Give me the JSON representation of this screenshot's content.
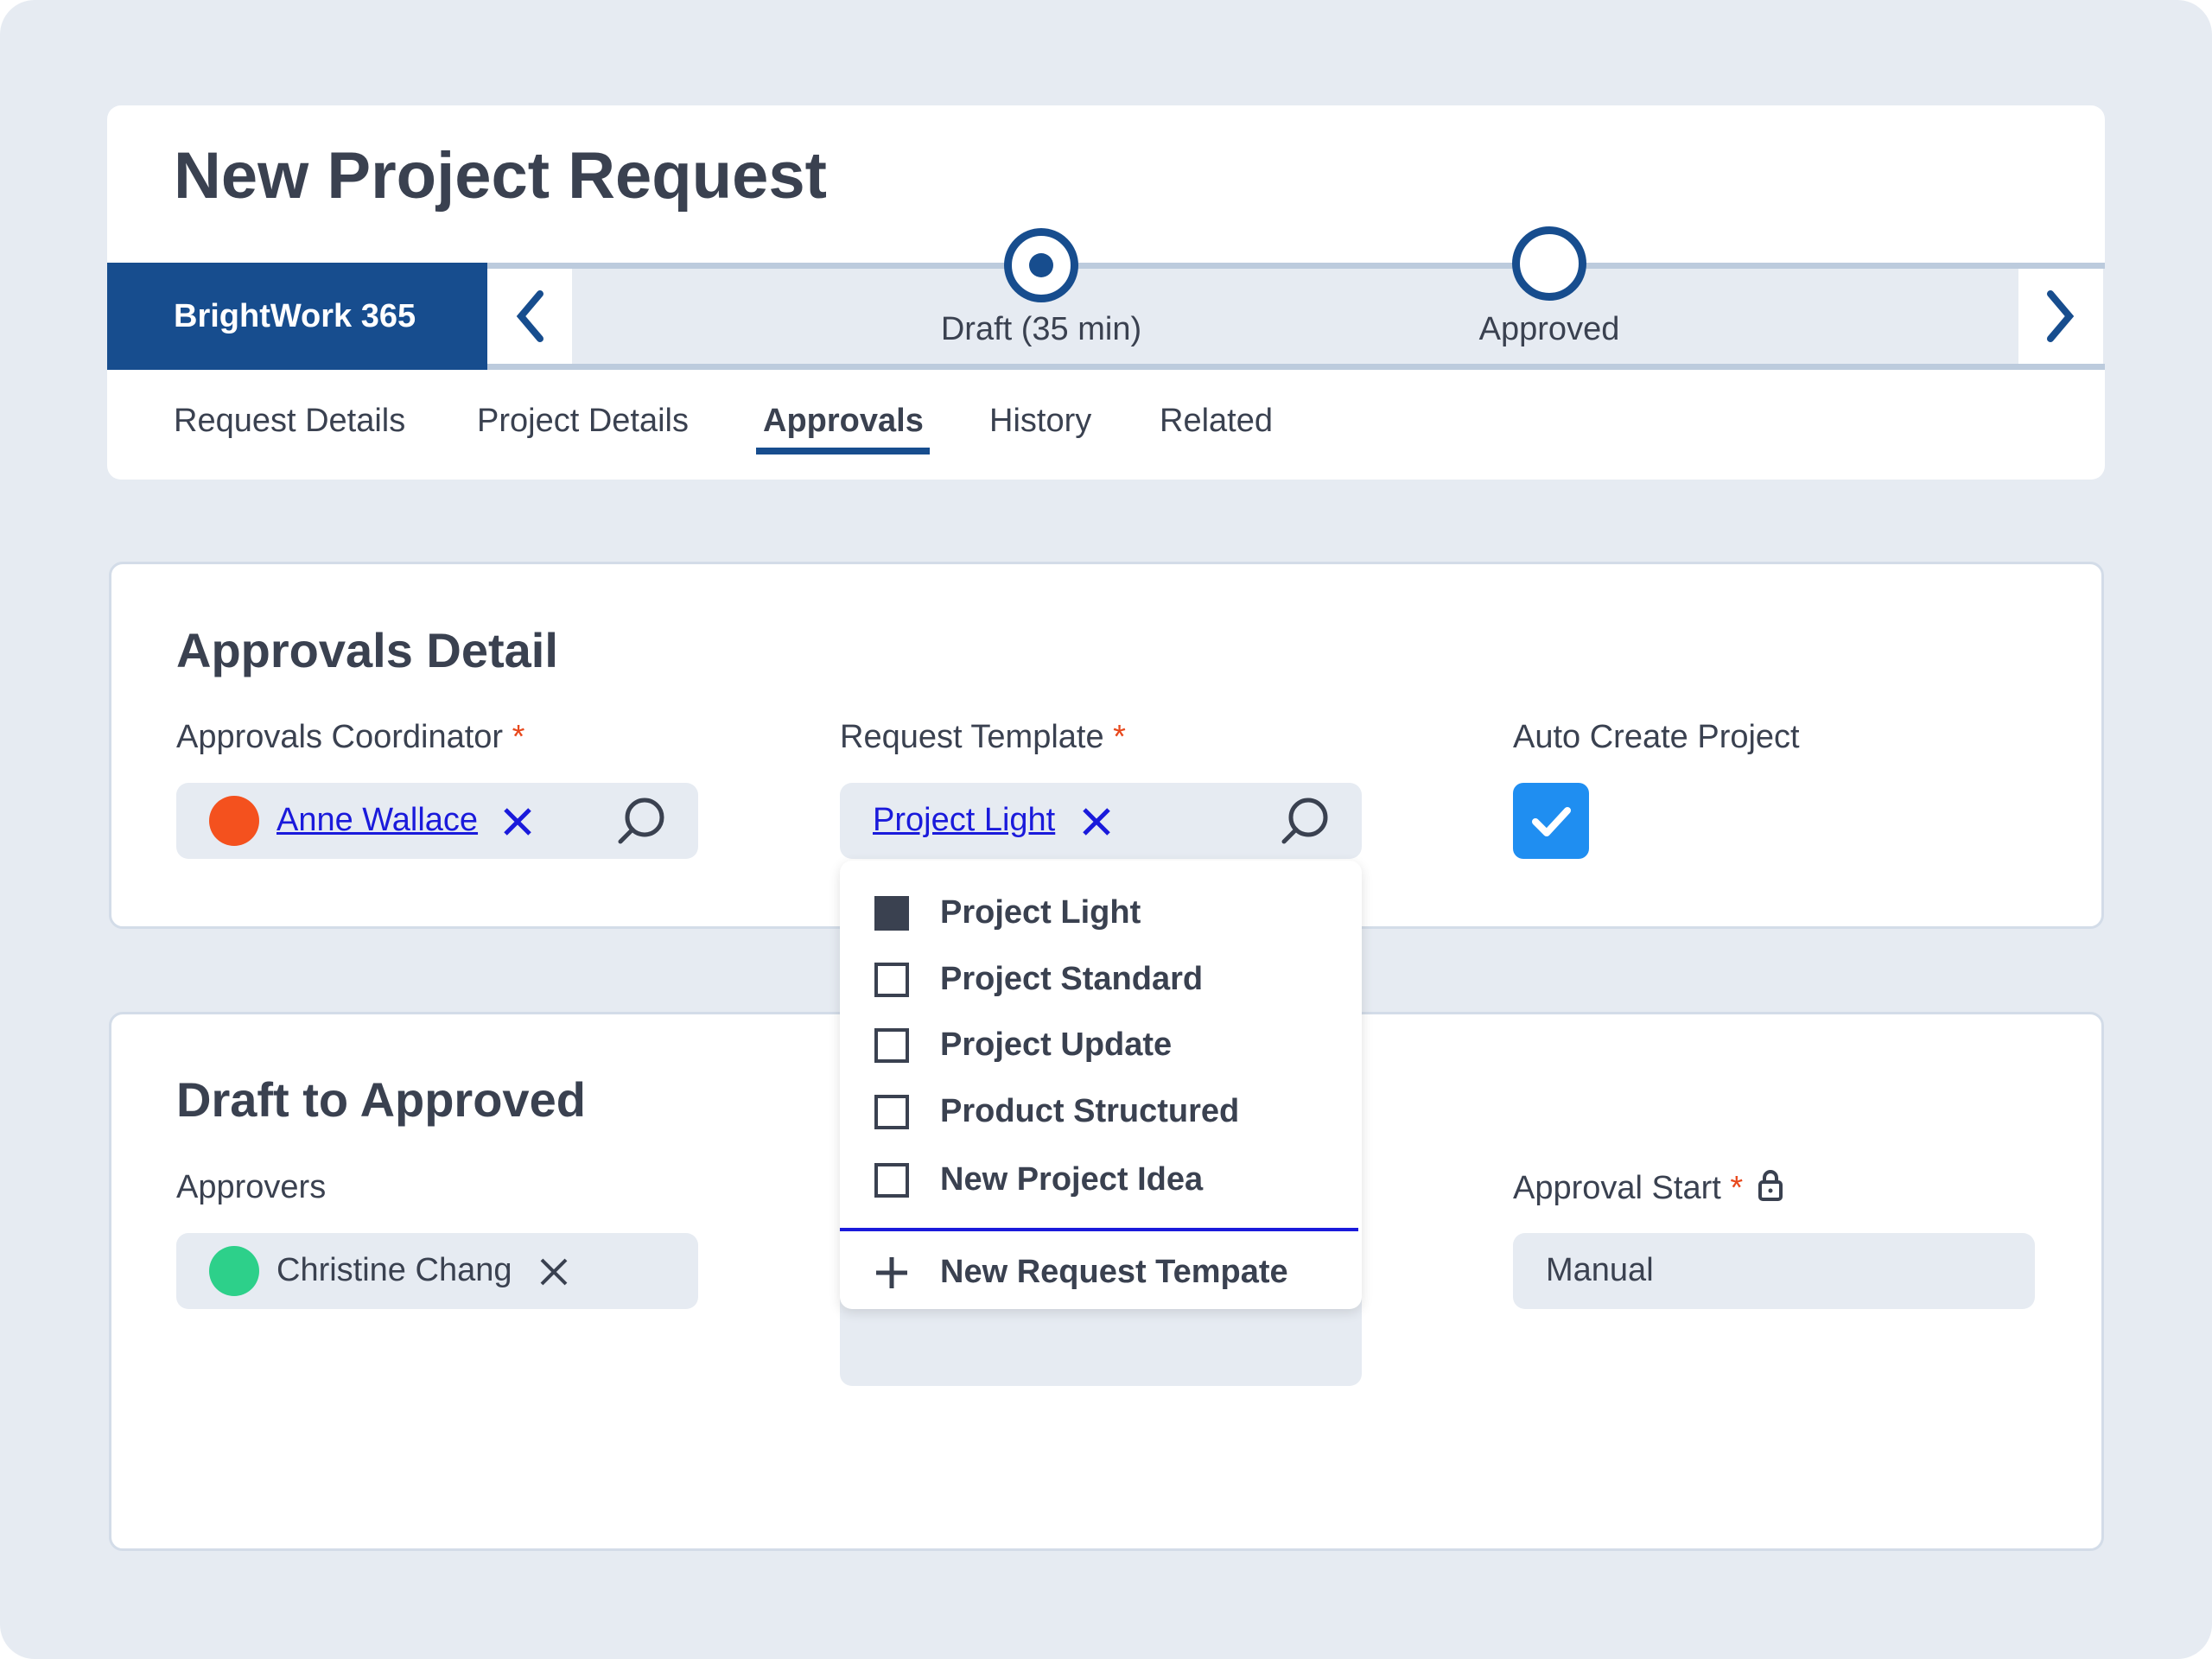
{
  "header": {
    "title": "New Project Request",
    "brand": "BrightWork 365"
  },
  "stages": [
    {
      "label": "Draft (35 min)",
      "state": "current"
    },
    {
      "label": "Approved",
      "state": "upcoming"
    }
  ],
  "tabs": [
    {
      "label": "Request Details"
    },
    {
      "label": "Project Details"
    },
    {
      "label": "Approvals",
      "active": true
    },
    {
      "label": "History"
    },
    {
      "label": "Related"
    }
  ],
  "approvals_detail": {
    "heading": "Approvals Detail",
    "coordinator": {
      "label": "Approvals Coordinator",
      "required": "*",
      "value": "Anne Wallace",
      "avatar_color": "#f4511e"
    },
    "template": {
      "label": "Request Template",
      "required": "*",
      "value": "Project Light"
    },
    "auto_create": {
      "label": "Auto Create Project",
      "checked": true,
      "color": "#1f8ef1"
    }
  },
  "draft_to_approved": {
    "heading": "Draft to Approved",
    "approvers": {
      "label": "Approvers",
      "value": "Christine Chang",
      "avatar_color": "#2dd08a"
    },
    "approval_start": {
      "label": "Approval Start",
      "required": "*",
      "value": "Manual"
    }
  },
  "dropdown": {
    "options": [
      {
        "label": "Project Light",
        "checked": true
      },
      {
        "label": "Project Standard",
        "checked": false
      },
      {
        "label": "Project Update",
        "checked": false
      },
      {
        "label": "Product Structured",
        "checked": false
      },
      {
        "label": "New Project Idea",
        "checked": false
      }
    ],
    "new_label": "New Request Tempate"
  },
  "colors": {
    "brand": "#174d8e",
    "link": "#1a1adb",
    "required": "#e8491d"
  }
}
